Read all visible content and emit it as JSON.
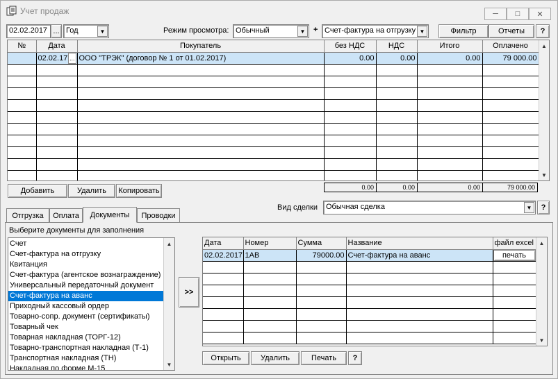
{
  "window": {
    "title": "Учет продаж"
  },
  "toolbar": {
    "date": "02.02.2017",
    "date_btn": "...",
    "period": "Год",
    "mode_label": "Режим просмотра:",
    "mode_value": "Обычный",
    "plus": "+",
    "doc_type": "Счет-фактура на отгрузку",
    "filter_label": "Фильтр",
    "reports_label": "Отчеты",
    "help": "?"
  },
  "main_table": {
    "columns": [
      "№",
      "Дата",
      "Покупатель",
      "без НДС",
      "НДС",
      "Итого",
      "Оплачено"
    ],
    "rows": [
      {
        "num": "",
        "date": "02.02.17",
        "buyer": "ООО \"ТРЭК\" (договор № 1 от 01.02.2017)",
        "no_vat": "0.00",
        "vat": "0.00",
        "total": "0.00",
        "paid": "79 000.00"
      }
    ],
    "totals": {
      "no_vat": "0.00",
      "vat": "0.00",
      "total": "0.00",
      "paid": "79 000.00"
    }
  },
  "actions": {
    "add": "Добавить",
    "delete": "Удалить",
    "copy": "Копировать"
  },
  "deal": {
    "label": "Вид сделки",
    "value": "Обычная сделка",
    "help": "?"
  },
  "tabs": [
    {
      "label": "Отгрузка"
    },
    {
      "label": "Оплата"
    },
    {
      "label": "Документы",
      "active": true
    },
    {
      "label": "Проводки"
    }
  ],
  "documents": {
    "prompt": "Выберите документы для заполнения",
    "items": [
      "Счет",
      "Счет-фактура на отгрузку",
      "Квитанция",
      "Счет-фактура (агентское вознаграждение)",
      "Универсальный передаточный документ",
      "Счет-фактура на аванс",
      "Приходный кассовый ордер",
      "Товарно-сопр. документ (сертификаты)",
      "Товарный чек",
      "Товарная накладная (ТОРГ-12)",
      "Товарно-транспортная накладная (Т-1)",
      "Транспортная накладная (ТН)",
      "Накладная по форме М-15"
    ],
    "selected_index": 5,
    "transfer": ">>"
  },
  "doc_table": {
    "columns": [
      "Дата",
      "Номер",
      "Сумма",
      "Название",
      "файл excel"
    ],
    "rows": [
      {
        "date": "02.02.2017",
        "number": "1АВ",
        "sum": "79000.00",
        "name": "Счет-фактура на аванс",
        "excel": "печать"
      }
    ]
  },
  "doc_actions": {
    "open": "Открыть",
    "delete": "Удалить",
    "print": "Печать",
    "help": "?"
  }
}
